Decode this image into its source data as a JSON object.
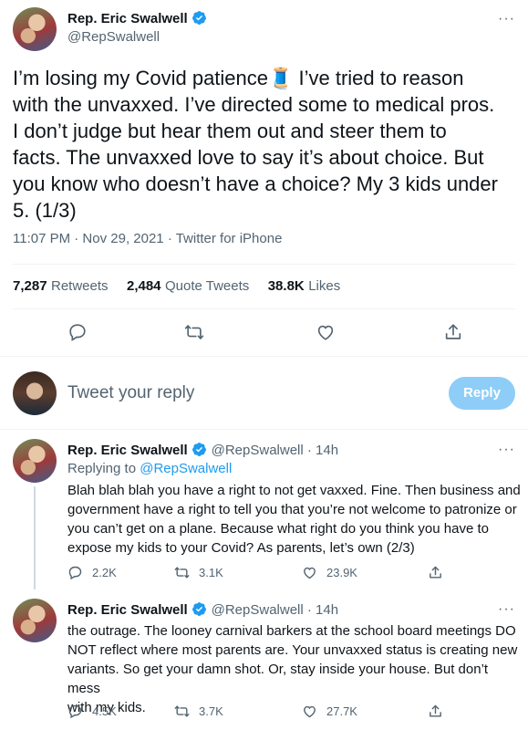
{
  "main_tweet": {
    "name": "Rep. Eric Swalwell",
    "handle": "@RepSwalwell",
    "text_lines": [
      "I’m losing my Covid patience🧵 I’ve tried to reason",
      "with the unvaxxed. I’ve directed some to medical pros.",
      "I don’t judge but hear them out and steer them to",
      "facts. The unvaxxed love to say it’s about choice. But",
      "you know who doesn’t have a choice? My 3 kids under",
      "5. (1/3)"
    ],
    "timestamp": "11:07 PM · Nov 29, 2021 · Twitter for iPhone",
    "retweets_count": "7,287",
    "retweets_label": "Retweets",
    "quote_count": "2,484",
    "quote_label": "Quote Tweets",
    "likes_count": "38.8K",
    "likes_label": "Likes"
  },
  "compose": {
    "placeholder": "Tweet your reply",
    "button_label": "Reply"
  },
  "replies": [
    {
      "name": "Rep. Eric Swalwell",
      "handle_time": "@RepSwalwell · 14h",
      "replying_prefix": "Replying to",
      "replying_handle": "@RepSwalwell",
      "text_lines": [
        "Blah blah blah you have a right to not get vaxxed. Fine. Then business and",
        "government have a right to tell you that you’re not welcome to patronize or",
        "you can’t get on a plane. Because what right do you think you have to",
        "expose my kids to your Covid? As parents, let’s own (2/3)"
      ],
      "reply_count": "2.2K",
      "retweet_count": "3.1K",
      "like_count": "23.9K"
    },
    {
      "name": "Rep. Eric Swalwell",
      "handle_time": "@RepSwalwell · 14h",
      "text_lines": [
        "the outrage. The looney carnival barkers at the school board meetings DO",
        "NOT reflect where most parents are. Your unvaxxed status is creating new",
        "variants. So get your damn shot. Or, stay inside your house. But don’t mess",
        "with my kids."
      ],
      "reply_count": "4.5K",
      "retweet_count": "3.7K",
      "like_count": "27.7K"
    }
  ],
  "more_icon": "···",
  "icons": [
    "verified-badge-icon",
    "reply-icon",
    "retweet-icon",
    "like-icon",
    "share-icon"
  ],
  "colors": {
    "accent": "#1d9bf0",
    "reply_button_disabled": "#8ecdf8",
    "secondary_text": "#536471"
  }
}
